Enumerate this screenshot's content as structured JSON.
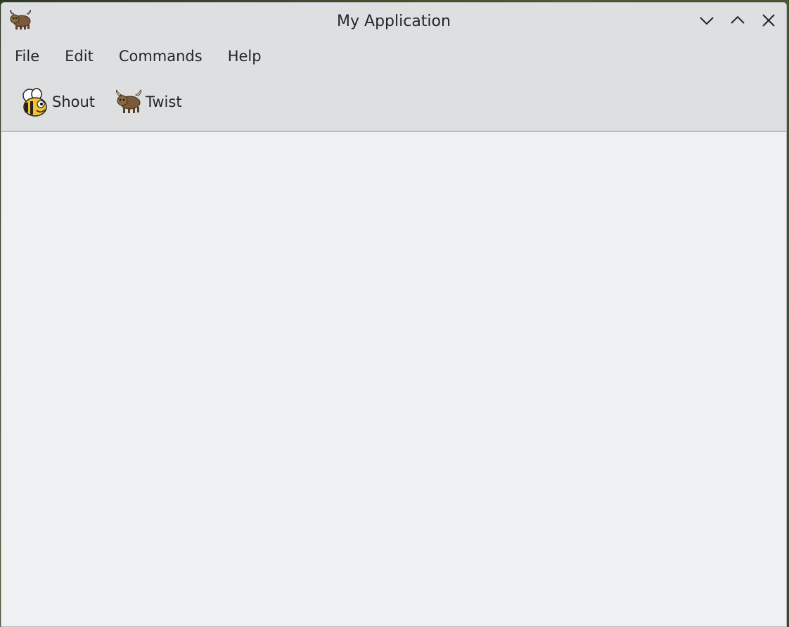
{
  "window": {
    "title": "My Application",
    "app_icon": "yak-icon"
  },
  "titlebar_buttons": {
    "minimize_icon": "chevron-down-icon",
    "maximize_icon": "chevron-up-icon",
    "close_icon": "close-icon"
  },
  "menubar": {
    "items": [
      {
        "label": "File"
      },
      {
        "label": "Edit"
      },
      {
        "label": "Commands"
      },
      {
        "label": "Help"
      }
    ]
  },
  "toolbar": {
    "buttons": [
      {
        "label": "Shout",
        "icon": "bee-face-icon"
      },
      {
        "label": "Twist",
        "icon": "yak-icon"
      }
    ]
  },
  "colors": {
    "window_bg": "#dedfe1",
    "content_bg": "#eff0f1",
    "text": "#232629"
  }
}
